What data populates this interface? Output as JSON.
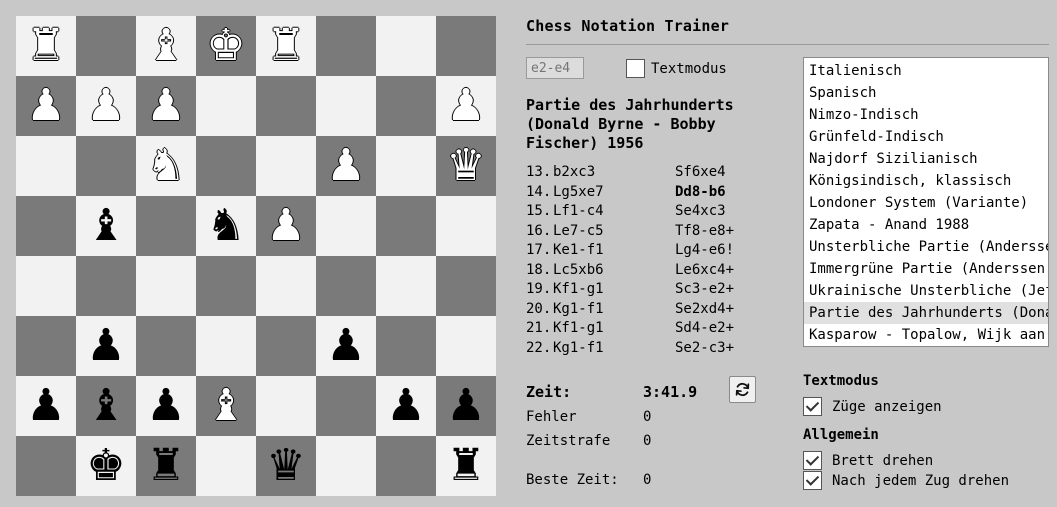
{
  "app": {
    "title": "Chess Notation Trainer"
  },
  "board": {
    "rows": [
      [
        [
          "R",
          "w"
        ],
        null,
        [
          "B",
          "w"
        ],
        [
          "K",
          "w"
        ],
        [
          "R",
          "w"
        ],
        null,
        null,
        null
      ],
      [
        [
          "P",
          "w"
        ],
        [
          "P",
          "w"
        ],
        [
          "P",
          "w"
        ],
        null,
        null,
        null,
        null,
        [
          "P",
          "w"
        ]
      ],
      [
        null,
        null,
        [
          "N",
          "w"
        ],
        null,
        null,
        [
          "P",
          "w"
        ],
        null,
        [
          "Q",
          "w"
        ]
      ],
      [
        null,
        [
          "B",
          "b"
        ],
        null,
        [
          "N",
          "b"
        ],
        [
          "P",
          "w"
        ],
        null,
        null,
        null
      ],
      [
        null,
        null,
        null,
        null,
        null,
        null,
        null,
        null
      ],
      [
        null,
        [
          "P",
          "b"
        ],
        null,
        null,
        null,
        [
          "P",
          "b"
        ],
        null,
        null
      ],
      [
        [
          "P",
          "b"
        ],
        [
          "B",
          "b"
        ],
        [
          "P",
          "b"
        ],
        [
          "B",
          "w"
        ],
        null,
        null,
        [
          "P",
          "b"
        ],
        [
          "P",
          "b"
        ]
      ],
      [
        null,
        [
          "K",
          "b"
        ],
        [
          "R",
          "b"
        ],
        null,
        [
          "Q",
          "b"
        ],
        null,
        null,
        [
          "R",
          "b"
        ]
      ]
    ],
    "glyphs": {
      "K": "♚",
      "Q": "♛",
      "R": "♜",
      "B": "♝",
      "N": "♞",
      "P": "♟"
    },
    "colors": {
      "light": "#f2f2f2",
      "dark": "#7a7a7a"
    }
  },
  "input": {
    "placeholder": "e2-e4",
    "value": ""
  },
  "textmodus_toggle": {
    "label": "Textmodus",
    "checked": false
  },
  "game": {
    "title": "Partie des Jahrhunderts (Donald Byrne - Bobby Fischer) 1956",
    "moves": [
      {
        "num": "13.",
        "white": "b2xc3",
        "black": "Sf6xe4"
      },
      {
        "num": "14.",
        "white": "Lg5xe7",
        "black": "Dd8-b6",
        "current": true
      },
      {
        "num": "15.",
        "white": "Lf1-c4",
        "black": "Se4xc3"
      },
      {
        "num": "16.",
        "white": "Le7-c5",
        "black": "Tf8-e8+"
      },
      {
        "num": "17.",
        "white": "Ke1-f1",
        "black": "Lg4-e6!"
      },
      {
        "num": "18.",
        "white": "Lc5xb6",
        "black": "Le6xc4+"
      },
      {
        "num": "19.",
        "white": "Kf1-g1",
        "black": "Sc3-e2+"
      },
      {
        "num": "20.",
        "white": "Kg1-f1",
        "black": "Se2xd4+"
      },
      {
        "num": "21.",
        "white": "Kf1-g1",
        "black": "Sd4-e2+"
      },
      {
        "num": "22.",
        "white": "Kg1-f1",
        "black": "Se2-c3+"
      }
    ]
  },
  "stats": {
    "zeit_label": "Zeit:",
    "zeit_value": "3:41.9",
    "fehler_label": "Fehler",
    "fehler_value": "0",
    "zeitstrafe_label": "Zeitstrafe",
    "zeitstrafe_value": "0",
    "beste_label": "Beste Zeit:",
    "beste_value": "0"
  },
  "gamelist": {
    "items": [
      "Italienisch",
      "Spanisch",
      "Nimzo-Indisch",
      "Grünfeld-Indisch",
      "Najdorf Sizilianisch",
      "Königsindisch, klassisch",
      "Londoner System (Variante)",
      "Zapata - Anand 1988",
      "Unsterbliche Partie (Anderssen",
      "Immergrüne Partie (Anderssen -",
      "Ukrainische Unsterbliche (Jefi",
      "Partie des Jahrhunderts (Donal",
      "Kasparow - Topalow, Wijk aan Z"
    ],
    "selected_index": 11
  },
  "options": {
    "textmodus_title": "Textmodus",
    "zuege_anzeigen": "Züge anzeigen",
    "allgemein_title": "Allgemein",
    "brett_drehen": "Brett drehen",
    "nach_jedem_zug": "Nach jedem Zug drehen"
  }
}
